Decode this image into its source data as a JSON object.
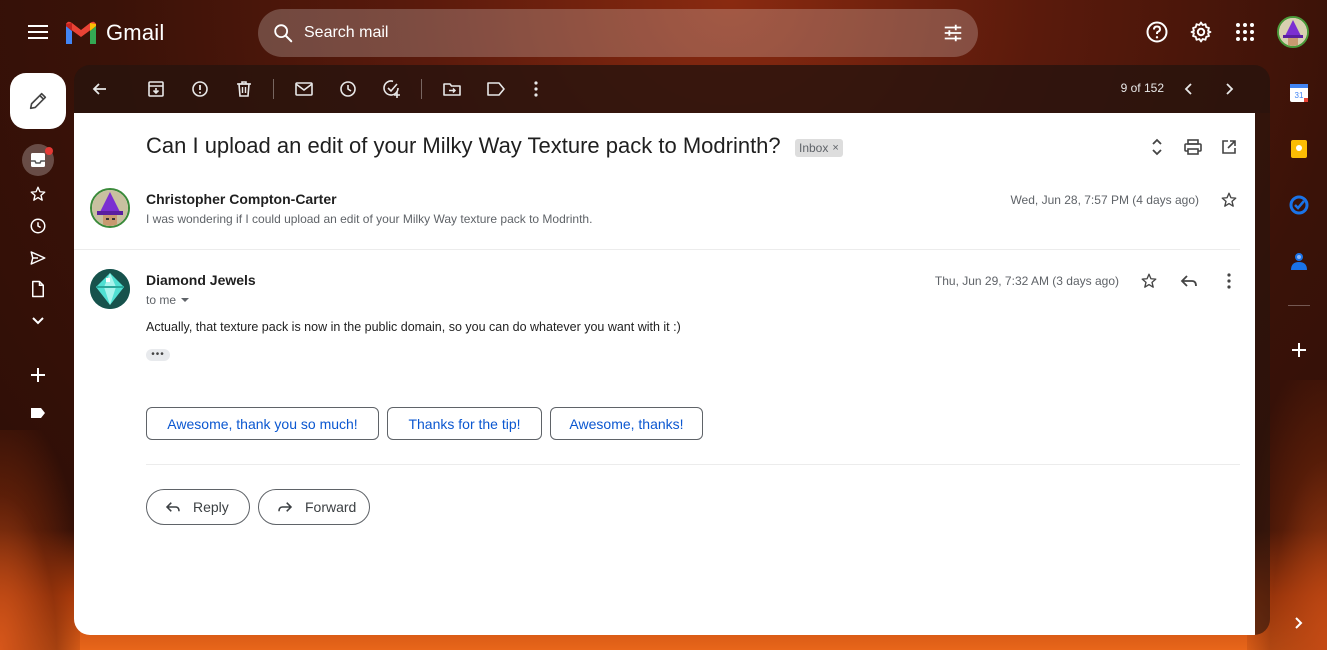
{
  "app": {
    "name": "Gmail"
  },
  "search": {
    "placeholder": "Search mail"
  },
  "toolbar": {
    "count": "9 of 152"
  },
  "thread": {
    "subject": "Can I upload an edit of your Milky Way Texture pack to Modrinth?",
    "label": "Inbox",
    "label_remove": "×"
  },
  "messages": [
    {
      "sender": "Christopher Compton-Carter",
      "snippet": "I was wondering if I could upload an edit of your Milky Way texture pack to Modrinth.",
      "date": "Wed, Jun 28, 7:57 PM (4 days ago)"
    },
    {
      "sender": "Diamond Jewels",
      "recipient": "to me",
      "date": "Thu, Jun 29, 7:32 AM (3 days ago)",
      "body": "Actually, that texture pack is now in the public domain, so you can do whatever you want with it :)",
      "trimmed": "•••"
    }
  ],
  "smart_replies": [
    "Awesome, thank you so much!",
    "Thanks for the tip!",
    "Awesome, thanks!"
  ],
  "actions": {
    "reply": "Reply",
    "forward": "Forward"
  },
  "colors": {
    "accent": "#0b57d0",
    "unread_dot": "#e53935"
  }
}
